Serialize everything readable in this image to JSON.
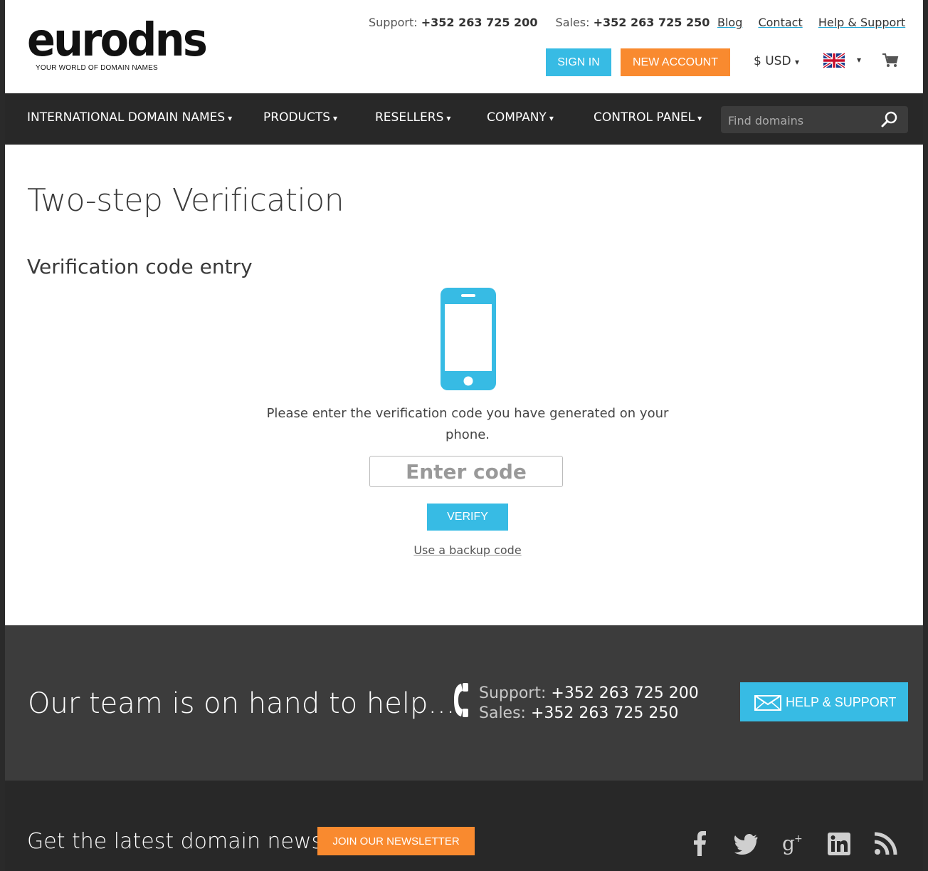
{
  "header": {
    "logo_text": "eurodns",
    "logo_tagline": "YOUR WORLD OF DOMAIN NAMES",
    "support_label": "Support:",
    "support_number": "+352 263 725 200",
    "sales_label": "Sales:",
    "sales_number": "+352 263 725 250",
    "links": [
      "Blog",
      "Contact",
      "Help & Support"
    ],
    "sign_in": "SIGN IN",
    "new_account": "NEW ACCOUNT",
    "currency": "$ USD",
    "caret": "▾"
  },
  "nav": {
    "items": [
      "INTERNATIONAL DOMAIN NAMES",
      "PRODUCTS",
      "RESELLERS",
      "COMPANY",
      "CONTROL PANEL"
    ],
    "caret": "▾",
    "search_placeholder": "Find domains"
  },
  "main": {
    "title": "Two-step Verification",
    "section_title": "Verification code entry",
    "instructions": "Please enter the verification code you have generated on your phone.",
    "code_placeholder": "Enter code",
    "verify_label": "VERIFY",
    "backup_link": "Use a backup code"
  },
  "help_band": {
    "title": "Our team is on hand to help...",
    "support_label": "Support:",
    "support_number": "+352 263 725 200",
    "sales_label": "Sales:",
    "sales_number": "+352 263 725 250",
    "button_label": "HELP & SUPPORT"
  },
  "news_band": {
    "title": "Get the latest domain news.",
    "button_label": "JOIN OUR NEWSLETTER",
    "social_icons": [
      "facebook-icon",
      "twitter-icon",
      "google-plus-icon",
      "linkedin-icon",
      "rss-icon"
    ]
  },
  "colors": {
    "accent_blue": "#37bbe4",
    "accent_orange": "#f98a2f",
    "nav_bg": "#282828",
    "help_bg": "#3c3c3c"
  }
}
